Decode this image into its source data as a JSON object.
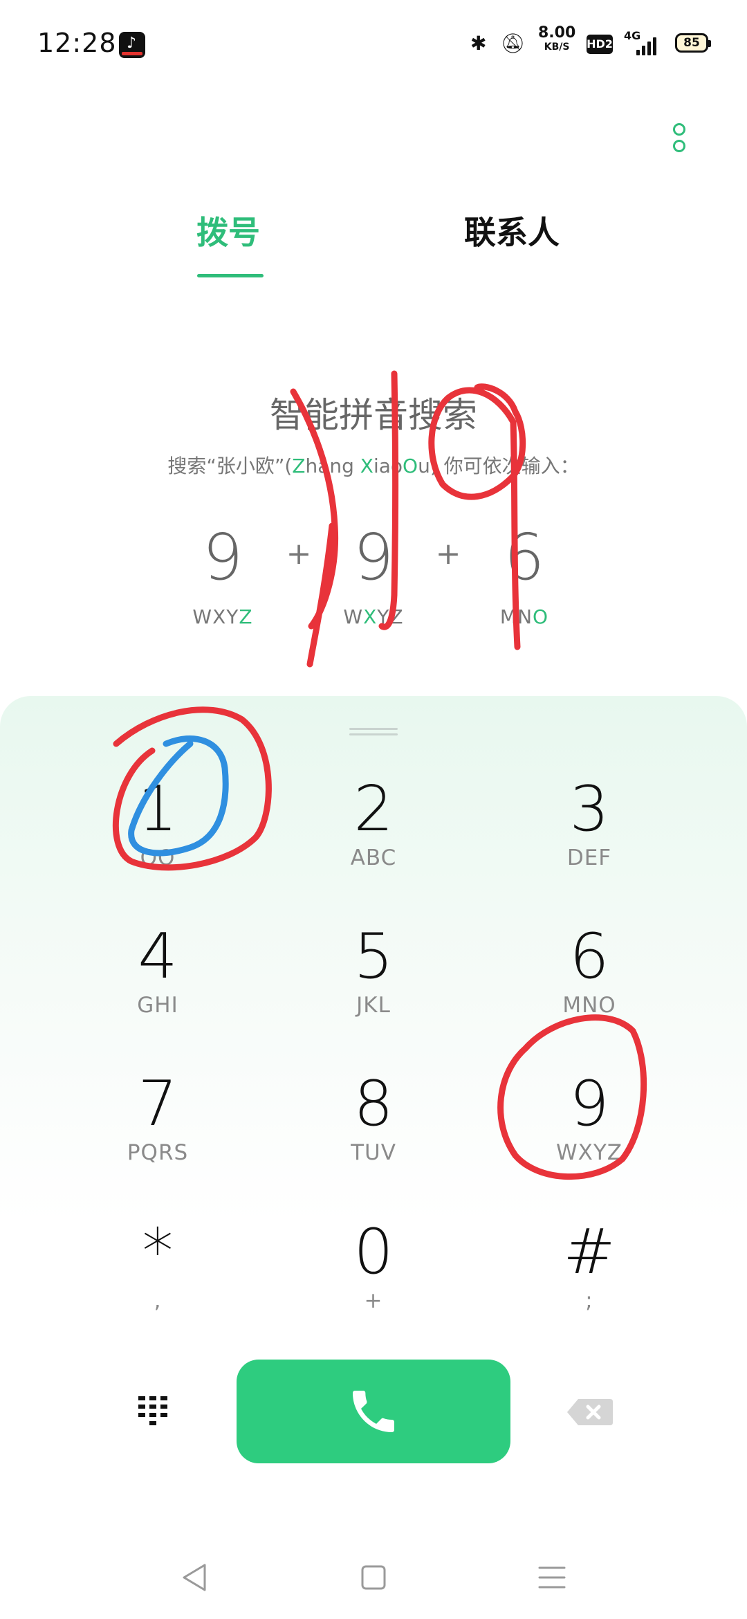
{
  "status": {
    "time": "12:28",
    "net_speed": "8.00",
    "net_speed_unit": "KB/S",
    "hd_badge": "HD2",
    "network": "4G",
    "battery": "85"
  },
  "tabs": {
    "dial": "拨号",
    "contacts": "联系人"
  },
  "hint": {
    "title": "智能拼音搜索",
    "desc_prefix": "搜索“张小欧”(",
    "desc_z": "Z",
    "desc_hang": "hang ",
    "desc_x": "X",
    "desc_iao": "iao",
    "desc_o": "O",
    "desc_u": "u",
    "desc_suffix": ") 你可依次输入：",
    "plus": "+",
    "digits": [
      {
        "digit": "9",
        "letters_main": "WXY",
        "letters_hl": "Z",
        "letters_tail": ""
      },
      {
        "digit": "9",
        "letters_main": "W",
        "letters_hl": "X",
        "letters_tail": "YZ"
      },
      {
        "digit": "6",
        "letters_main": "MN",
        "letters_hl": "O",
        "letters_tail": ""
      }
    ]
  },
  "keypad": [
    {
      "digit": "1",
      "letters": "QQ"
    },
    {
      "digit": "2",
      "letters": "ABC"
    },
    {
      "digit": "3",
      "letters": "DEF"
    },
    {
      "digit": "4",
      "letters": "GHI"
    },
    {
      "digit": "5",
      "letters": "JKL"
    },
    {
      "digit": "6",
      "letters": "MNO"
    },
    {
      "digit": "7",
      "letters": "PQRS"
    },
    {
      "digit": "8",
      "letters": "TUV"
    },
    {
      "digit": "9",
      "letters": "WXYZ"
    },
    {
      "digit": "*",
      "letters": ","
    },
    {
      "digit": "0",
      "letters": "+"
    },
    {
      "digit": "#",
      "letters": ";"
    }
  ],
  "icons": {
    "call": "phone-icon",
    "delete": "backspace-icon",
    "dialpad": "dialpad-icon",
    "menu": "more-vertical-icon"
  },
  "colors": {
    "accent": "#2fbd7a",
    "call_button": "#2ecc7f",
    "annotation_red": "#e8333a",
    "annotation_blue": "#2f8fe0"
  }
}
